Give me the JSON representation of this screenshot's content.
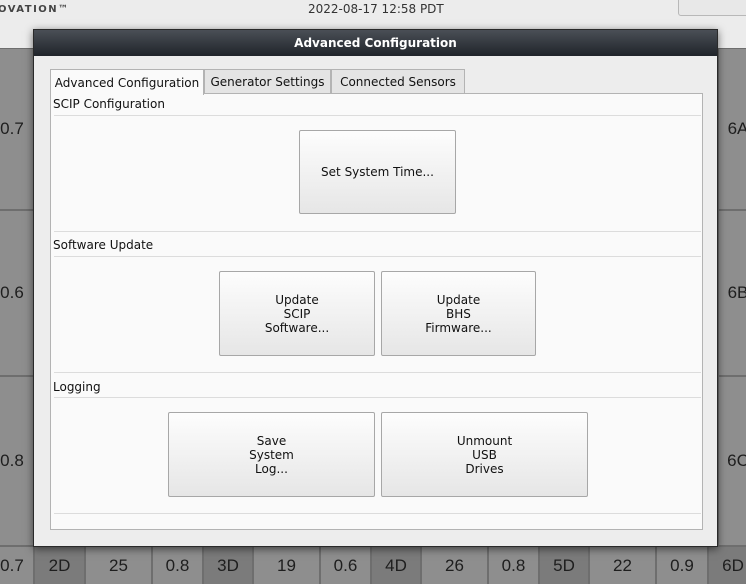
{
  "background": {
    "brand": "OVATION™",
    "datetime": "2022-08-17 12:58 PDT",
    "edge_cells": {
      "left": [
        "0.7",
        "0.6",
        "0.8",
        "0.7"
      ],
      "right": [
        "6A",
        "6B",
        "6C",
        "6D"
      ],
      "bottom": [
        "2D",
        "25",
        "0.8",
        "3D",
        "19",
        "0.6",
        "4D",
        "26",
        "0.8",
        "5D",
        "22",
        "0.9"
      ]
    }
  },
  "dialog": {
    "title": "Advanced Configuration",
    "tabs": [
      {
        "label": "Advanced Configuration",
        "active": true
      },
      {
        "label": "Generator Settings",
        "active": false
      },
      {
        "label": "Connected Sensors",
        "active": false
      }
    ],
    "sections": {
      "scip": {
        "label": "SCIP Configuration",
        "buttons": {
          "set_time": "Set System Time..."
        }
      },
      "software": {
        "label": "Software Update",
        "buttons": {
          "update_scip": "Update\nSCIP\nSoftware...",
          "update_bhs": "Update\nBHS\nFirmware..."
        }
      },
      "logging": {
        "label": "Logging",
        "buttons": {
          "save_log": "Save\nSystem\nLog...",
          "unmount_usb": "Unmount\nUSB\nDrives"
        }
      }
    }
  }
}
